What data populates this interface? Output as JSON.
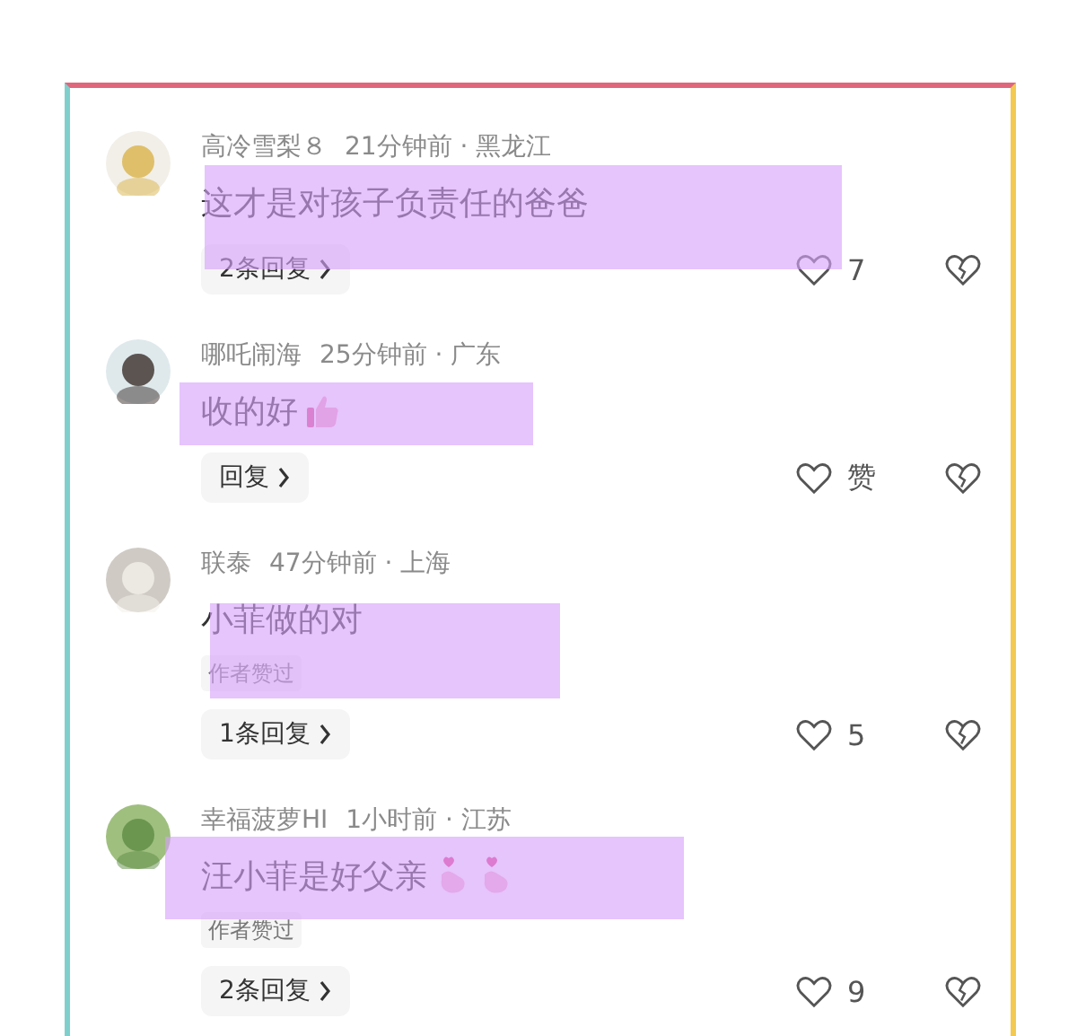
{
  "comments": [
    {
      "name": "高冷雪梨８",
      "time": "21分钟前 · 黑龙江",
      "text": "这才是对孩子负责任的爸爸",
      "reply": "2条回复",
      "likes": "7",
      "liked": false,
      "highlighted": true
    },
    {
      "name": "哪吒闹海",
      "time": "25分钟前 · 广东",
      "text": "收的好",
      "emojis": [
        {
          "kind": "thumbs-up"
        }
      ],
      "reply": "回复",
      "likes": "赞",
      "liked": false,
      "highlighted": true
    },
    {
      "name": "联泰",
      "time": "47分钟前 · 上海",
      "text": "小菲做的对",
      "tag": "作者赞过",
      "reply": "1条回复",
      "likes": "5",
      "liked": false,
      "highlighted": true
    },
    {
      "name": "幸福菠萝HI",
      "time": "1小时前 · 江苏",
      "text": "汪小菲是好父亲",
      "emojis": [
        {
          "kind": "finger-heart"
        },
        {
          "kind": "finger-heart"
        }
      ],
      "tag": "作者赞过",
      "reply": "2条回复",
      "likes": "9",
      "liked": false,
      "highlighted": true
    }
  ]
}
